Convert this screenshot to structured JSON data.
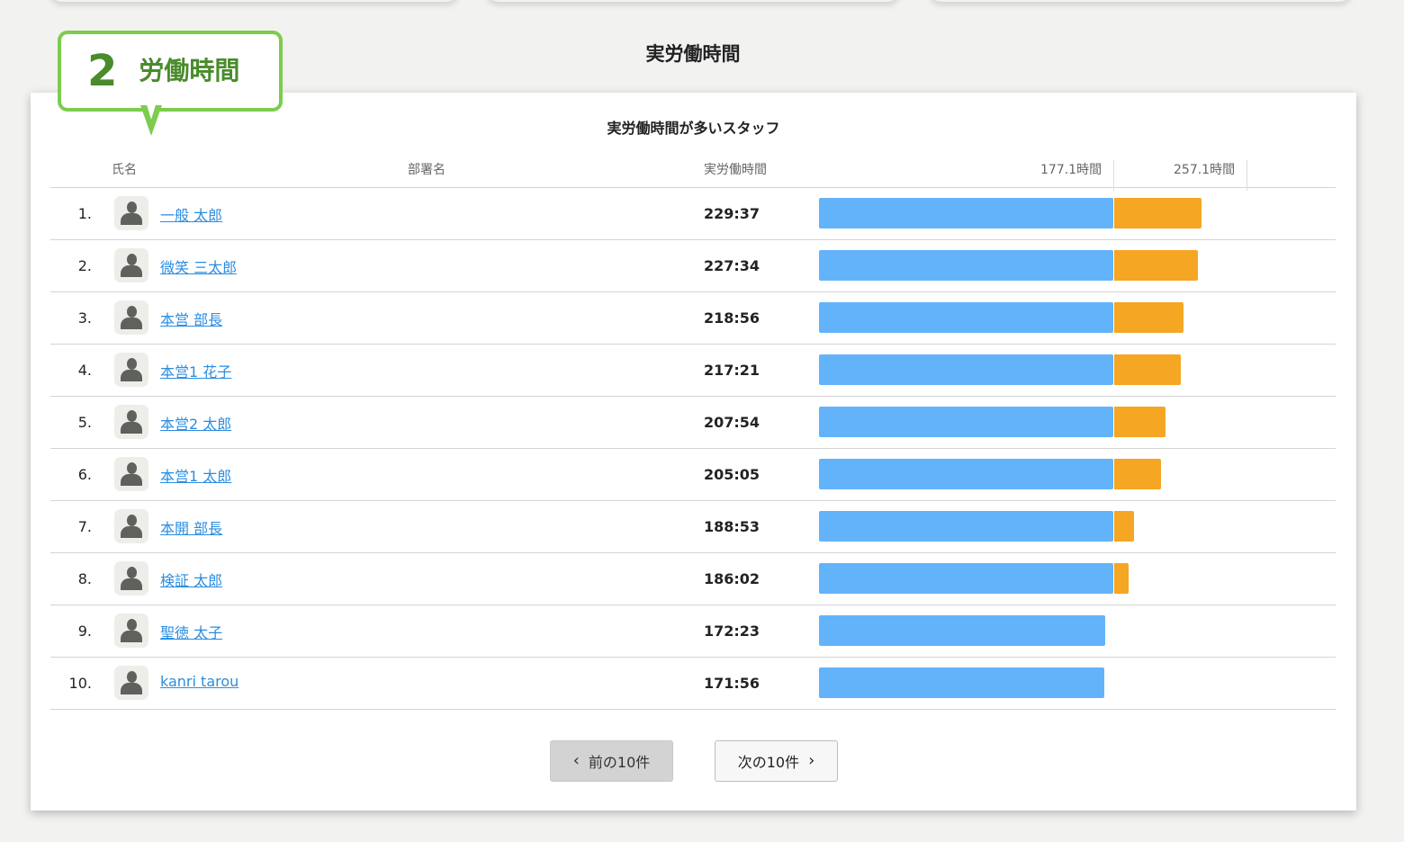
{
  "page_title": "実労働時間",
  "callout": {
    "number": "2",
    "label": "労働時間"
  },
  "card": {
    "title": "実労働時間が多いスタッフ",
    "headers": {
      "name": "氏名",
      "department": "部署名",
      "hours": "実労働時間"
    },
    "scale": {
      "mid_label": "177.1時間",
      "max_label": "257.1時間",
      "mid_hours": 177.1,
      "max_hours": 257.1
    },
    "rows": [
      {
        "rank": "1.",
        "name": "一般 太郎",
        "department": "",
        "hours": "229:37"
      },
      {
        "rank": "2.",
        "name": "微笑 三太郎",
        "department": "",
        "hours": "227:34"
      },
      {
        "rank": "3.",
        "name": "本営 部長",
        "department": "",
        "hours": "218:56"
      },
      {
        "rank": "4.",
        "name": "本営1 花子",
        "department": "",
        "hours": "217:21"
      },
      {
        "rank": "5.",
        "name": "本営2 太郎",
        "department": "",
        "hours": "207:54"
      },
      {
        "rank": "6.",
        "name": "本営1 太郎",
        "department": "",
        "hours": "205:05"
      },
      {
        "rank": "7.",
        "name": "本開 部長",
        "department": "",
        "hours": "188:53"
      },
      {
        "rank": "8.",
        "name": "検証 太郎",
        "department": "",
        "hours": "186:02"
      },
      {
        "rank": "9.",
        "name": "聖徳 太子",
        "department": "",
        "hours": "172:23"
      },
      {
        "rank": "10.",
        "name": "kanri tarou",
        "department": "",
        "hours": "171:56"
      }
    ],
    "pager": {
      "prev_label": "前の10件",
      "next_label": "次の10件",
      "prev_icon": "chevron-left-icon",
      "next_icon": "chevron-right-icon"
    }
  },
  "colors": {
    "base_bar": "#63b3fb",
    "over_bar": "#f5a623",
    "callout_border": "#7ccc4e",
    "link": "#2b8de0"
  }
}
